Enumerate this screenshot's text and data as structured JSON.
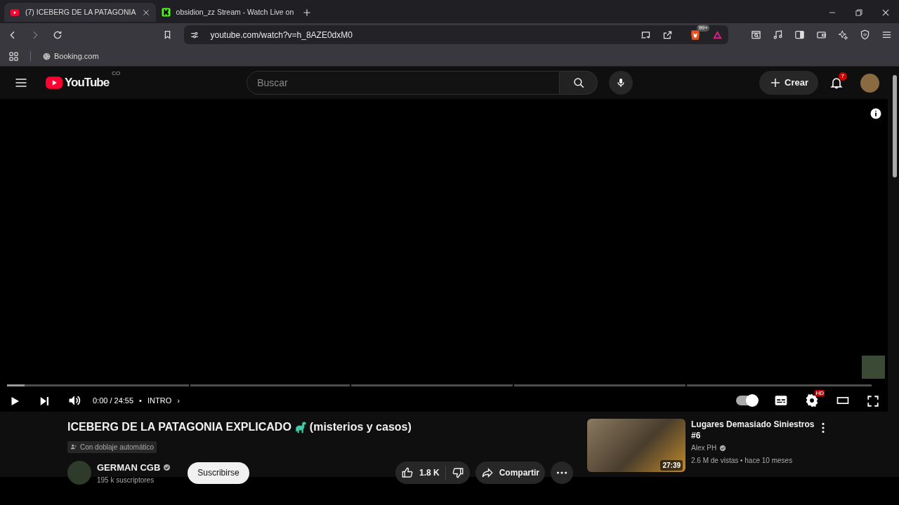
{
  "browser": {
    "tabs": [
      {
        "title": "(7) ICEBERG DE LA PATAGONIA",
        "kind": "video",
        "selected": true
      },
      {
        "title": "obsidion_zz Stream - Watch Live on",
        "kind": "stream",
        "selected": false
      }
    ],
    "address_bar": {
      "url": "youtube.com/watch?v=h_8AZE0dxM0"
    },
    "shields_badge": "99+",
    "bookmarks": [
      {
        "label": "Booking.com"
      }
    ]
  },
  "youtube": {
    "header": {
      "logo_text": "YouTube",
      "country_code": "CO",
      "search": {
        "placeholder": "Buscar"
      },
      "create_label": "Crear",
      "notification_count": "7"
    },
    "player": {
      "progress": {
        "level": 0.02
      },
      "time": "0:00 / 24:55",
      "separator": "•",
      "chapter": "INTRO",
      "chapter_arrow": "›",
      "autoplay_on": true,
      "quality_badge": "HD"
    },
    "video": {
      "title_start": "ICEBERG DE LA PATAGONIA EXPLICADO",
      "title_end": "(misterios y casos)",
      "dub_label": "Con doblaje automático",
      "channel": {
        "name": "GERMAN CGB",
        "verified": true,
        "subscribers": "195 k suscriptores"
      },
      "subscribe_label": "Suscribirse",
      "likes": "1.8 K",
      "share_label": "Compartir"
    },
    "recommendations": [
      {
        "title": "Lugares Demasiado Siniestros #6",
        "channel": "Alex PH",
        "verified": true,
        "meta": "2.6 M de vistas • hace 10 meses",
        "duration": "27:39"
      }
    ]
  }
}
